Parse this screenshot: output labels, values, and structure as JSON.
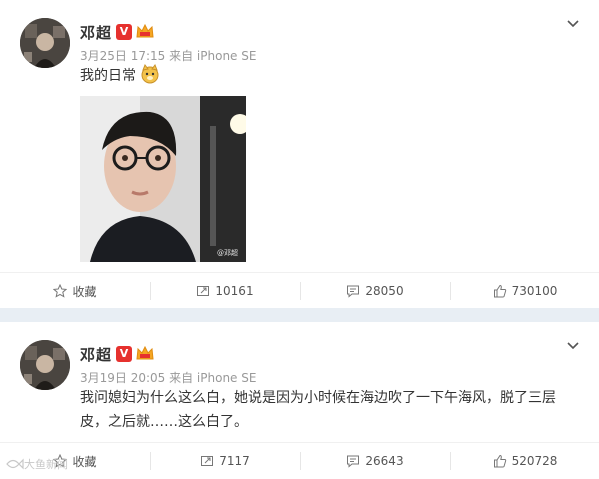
{
  "posts": [
    {
      "author": "邓超",
      "verified_badge": "V",
      "meta": "3月25日 17:15 来自 iPhone SE",
      "text": "我的日常",
      "emoji": "doge-emoji",
      "photo_watermark": "@邓超",
      "actions": {
        "favorite": "收藏",
        "repost": "10161",
        "comment": "28050",
        "like": "730100"
      }
    },
    {
      "author": "邓超",
      "verified_badge": "V",
      "meta": "3月19日 20:05 来自 iPhone SE",
      "text_line1": "我问媳妇为什么这么白，她说是因为小时候在海边吹了一下午海风，脱了三层",
      "text_line2": "皮，之后就……这么白了。",
      "actions": {
        "favorite": "收藏",
        "repost": "7117",
        "comment": "26643",
        "like": "520728"
      }
    }
  ],
  "page_watermark": "大鱼新闻",
  "colors": {
    "verified": "#e6312e",
    "meta": "#999999",
    "separator": "#e8eef4",
    "text": "#333333"
  }
}
